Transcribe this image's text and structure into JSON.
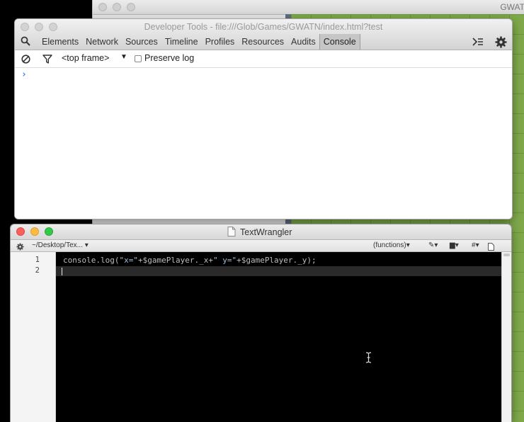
{
  "background_window": {
    "title": "GWAT"
  },
  "devtools": {
    "title": "Developer Tools - file:///Glob/Games/GWATN/index.html?test",
    "tabs": [
      {
        "label": "Elements"
      },
      {
        "label": "Network"
      },
      {
        "label": "Sources"
      },
      {
        "label": "Timeline"
      },
      {
        "label": "Profiles"
      },
      {
        "label": "Resources"
      },
      {
        "label": "Audits"
      },
      {
        "label": "Console"
      }
    ],
    "active_tab": "Console",
    "toolbar": {
      "frame_label": "<top frame>",
      "frame_arrow": "▼",
      "preserve_log_label": "Preserve log",
      "preserve_log_checked": false
    },
    "console": {
      "prompt": "›"
    },
    "icons": {
      "search": "search-icon",
      "drawer": "console-drawer-icon",
      "settings": "gear-icon",
      "clear": "clear-console-icon",
      "filter": "filter-icon"
    },
    "accent_color": "#3b83e5"
  },
  "textwrangler": {
    "title": "TextWrangler",
    "path": "~/Desktop/Tex...",
    "functions_menu": "(functions)",
    "hash_menu": "#",
    "line_numbers": [
      "1",
      "2"
    ],
    "code": {
      "line1_prefix": "console.log(",
      "line1_str1": "\"x=\"",
      "line1_mid": "+$gamePlayer._x+",
      "line1_str2": "\" y=\"",
      "line1_suffix": "+$gamePlayer._y);",
      "line2": ""
    },
    "traffic_lights": {
      "close": "#fc605c",
      "minimize": "#fdbc40",
      "zoom": "#34c84a"
    }
  }
}
